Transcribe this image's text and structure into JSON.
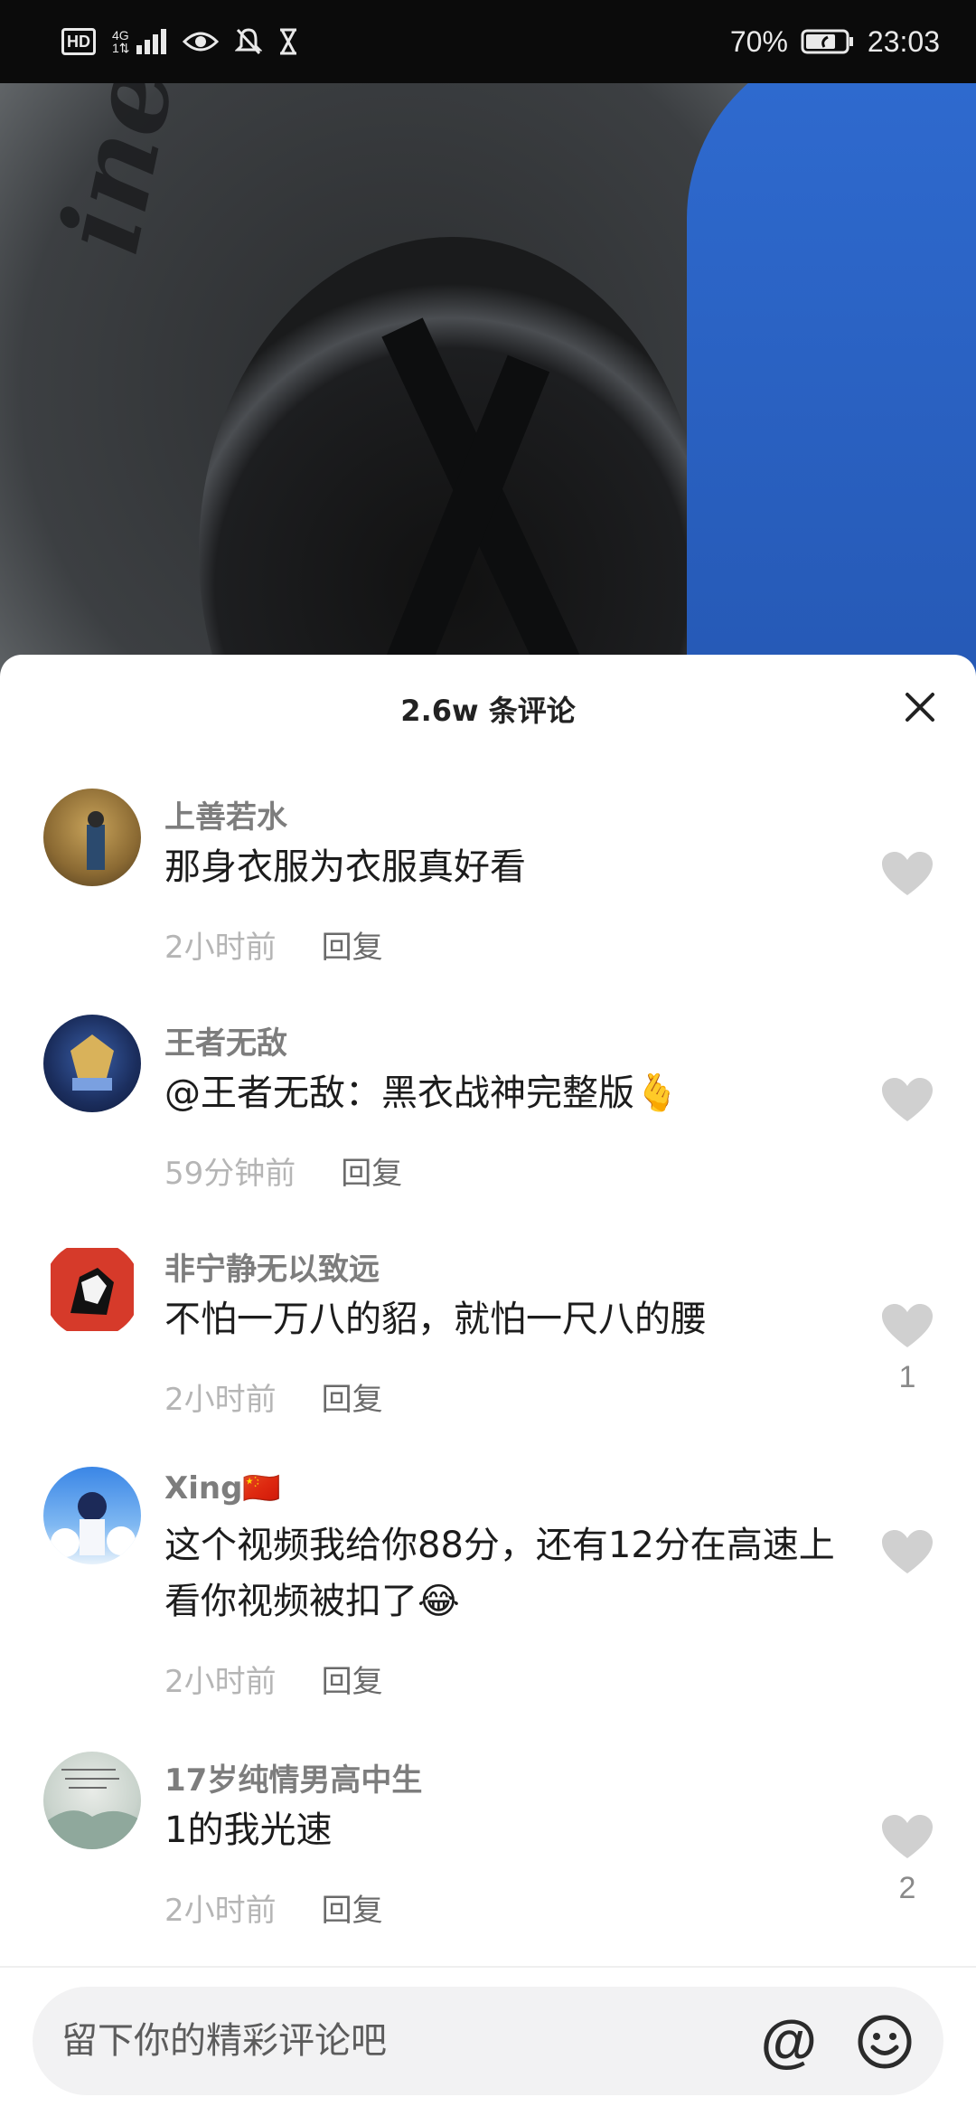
{
  "status_bar": {
    "left_badge": "HD",
    "network_top": "4G",
    "network_bottom": "1⇅",
    "battery": "70%",
    "time": "23:03"
  },
  "video": {
    "brand_text": "inental"
  },
  "comments_panel": {
    "title": "2.6w 条评论",
    "close_icon": "close-icon",
    "comments": [
      {
        "user": "上善若水",
        "text": "那身衣服为衣服真好看",
        "time": "2小时前",
        "reply": "回复",
        "likes": ""
      },
      {
        "user": "王者无敌",
        "text": "@王者无敌：黑衣战神完整版🫰",
        "time": "59分钟前",
        "reply": "回复",
        "likes": ""
      },
      {
        "user": "非宁静无以致远",
        "text": "不怕一万八的貂，就怕一尺八的腰",
        "time": "2小时前",
        "reply": "回复",
        "likes": "1"
      },
      {
        "user": "Xing🇨🇳",
        "text": "这个视频我给你88分，还有12分在高速上看你视频被扣了😂",
        "time": "2小时前",
        "reply": "回复",
        "likes": ""
      },
      {
        "user": "17岁纯情男高中生",
        "text": "1的我光速",
        "time": "2小时前",
        "reply": "回复",
        "likes": "2"
      }
    ]
  },
  "input": {
    "placeholder": "留下你的精彩评论吧",
    "at_symbol": "@"
  },
  "colors": {
    "sheet_bg": "#ffffff",
    "username": "#7d7d7d",
    "meta": "#b5b5b5",
    "heart": "#d0d0d0"
  }
}
